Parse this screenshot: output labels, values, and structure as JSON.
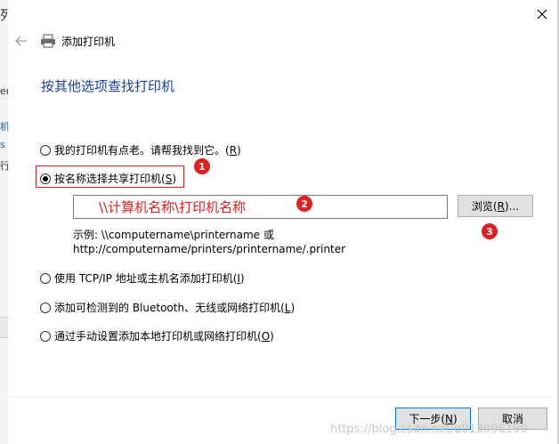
{
  "window": {
    "title": "添加打印机",
    "background_sliver": [
      "列",
      "er",
      "",
      "机",
      "s",
      "行"
    ]
  },
  "heading": "按其他选项查找打印机",
  "options": [
    {
      "pre": "我的打印机有点老。请帮我找到它。(",
      "key": "R",
      "post": ")",
      "selected": false
    },
    {
      "pre": "按名称选择共享打印机(",
      "key": "S",
      "post": ")",
      "selected": true
    },
    {
      "pre": "使用 TCP/IP 地址或主机名添加打印机(",
      "key": "I",
      "post": ")",
      "selected": false
    },
    {
      "pre": "添加可检测到的 Bluetooth、无线或网络打印机(",
      "key": "L",
      "post": ")",
      "selected": false
    },
    {
      "pre": "通过手动设置添加本地打印机或网络打印机(",
      "key": "O",
      "post": ")",
      "selected": false
    }
  ],
  "printer_name_input": {
    "value": "\\\\计算机名称\\打印机名称"
  },
  "browse_button": {
    "pre": "浏览(",
    "key": "R",
    "post": ")..."
  },
  "example": {
    "line1": "示例: \\\\computername\\printername 或",
    "line2": "http://computername/printers/printername/.printer"
  },
  "annotations": [
    "1",
    "2",
    "3"
  ],
  "footer": {
    "next_button": {
      "pre": "下一步(",
      "key": "N",
      "post": ")"
    },
    "cancel_button": "取消"
  },
  "watermark": "https://blog.csdn.net/u013096199"
}
